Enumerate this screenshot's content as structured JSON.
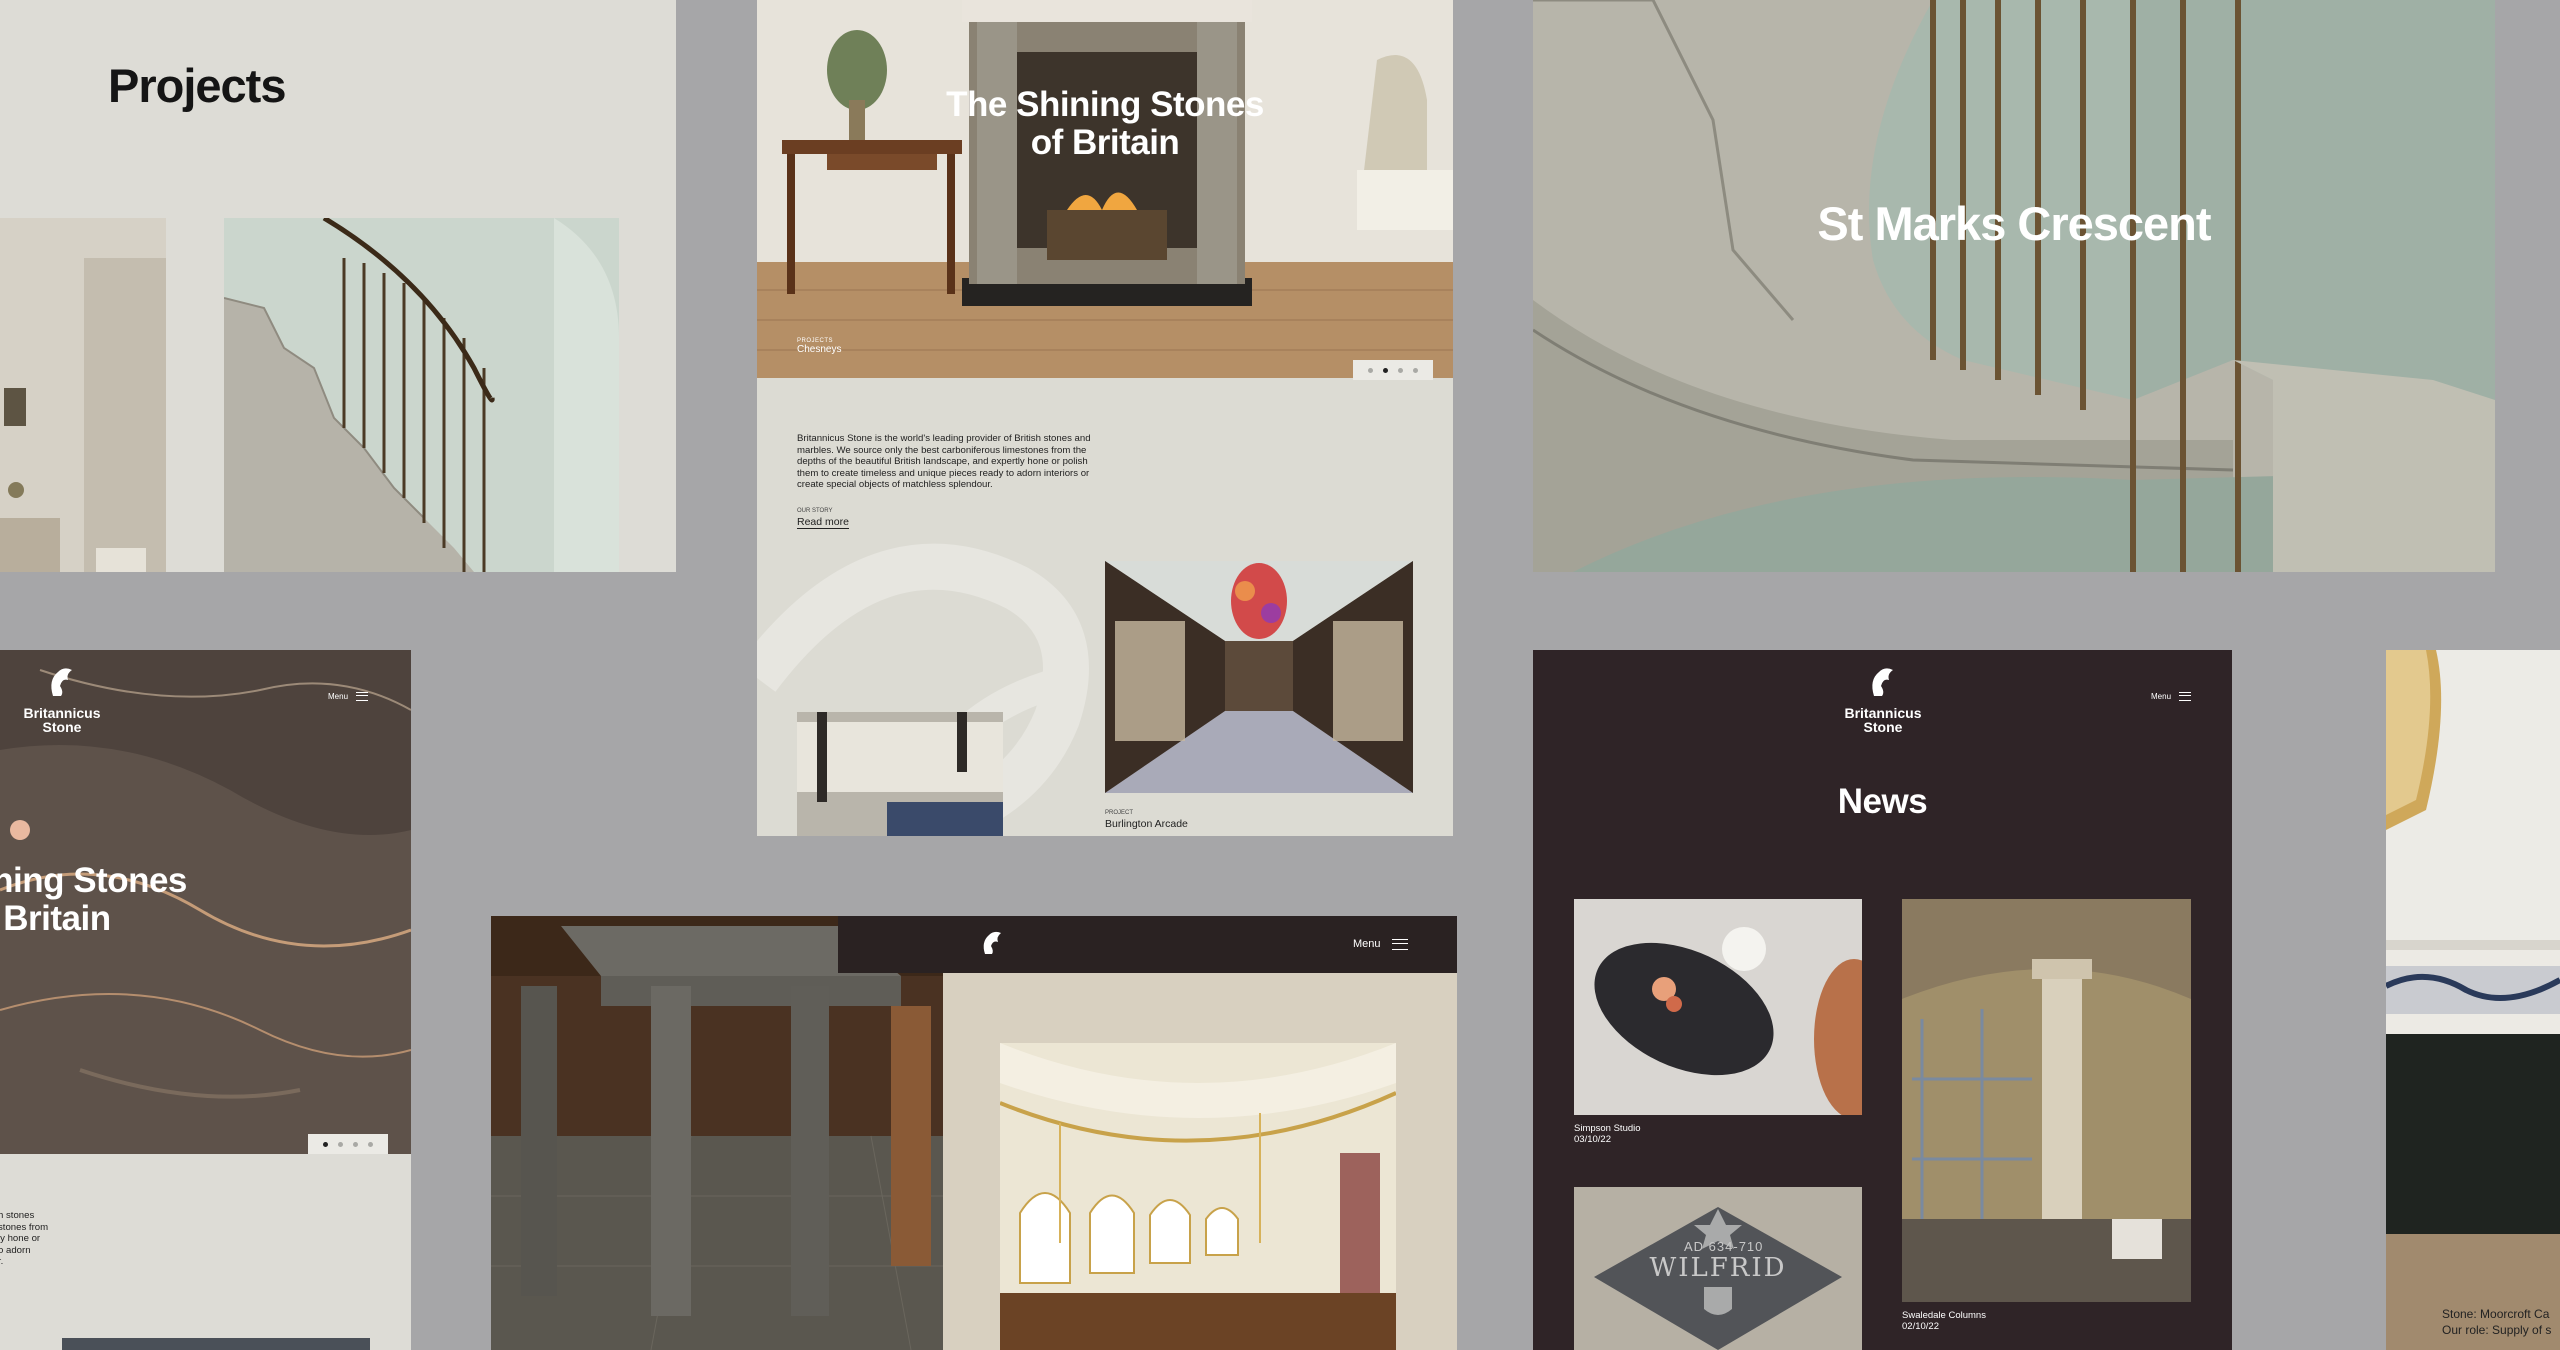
{
  "projects_card": {
    "title": "Projects"
  },
  "fireplace_card": {
    "hero_title_line1": "The Shining Stones",
    "hero_title_line2": "of Britain",
    "caption_small": "PROJECTS",
    "caption_name": "Chesneys",
    "slider": {
      "count": 4,
      "active": 2
    },
    "intro": "Britannicus Stone is the world's leading provider of British stones and marbles. We source only the best carboniferous limestones from the depths of the beautiful British landscape, and expertly hone or polish them to create timeless and unique pieces ready to adorn interiors or create special objects of matchless splendour.",
    "story_small": "OUR STORY",
    "story_link": "Read more",
    "project_small": "PROJECT",
    "project_name": "Burlington Arcade"
  },
  "stmarks_card": {
    "title": "St Marks Crescent"
  },
  "marble_card": {
    "brand_line1": "Britannicus",
    "brand_line2": "Stone",
    "menu_label": "Menu",
    "hero_title_line1": "hining Stones",
    "hero_title_line2": "of Britain",
    "slider": {
      "count": 4,
      "active": 1
    },
    "intro_fragment": "h stones\nstones from\nly hone or\no adorn\nr."
  },
  "church_card": {
    "menu_label": "Menu"
  },
  "news_card": {
    "brand_line1": "Britannicus",
    "brand_line2": "Stone",
    "menu_label": "Menu",
    "title": "News",
    "items": [
      {
        "title": "Simpson Studio",
        "date": "03/10/22"
      },
      {
        "title": "Swaledale Columns",
        "date": "02/10/22"
      },
      {
        "title": "WILFRID",
        "date": ""
      }
    ],
    "plaque_text": "AD 634-710"
  },
  "partial_card": {
    "stone_line": "Stone: Moorcroft Ca",
    "role_line": "Our role: Supply of s"
  },
  "colors": {
    "canvas": "#a6a6a8",
    "paper": "#dddcd6",
    "dark": "#2f2427"
  }
}
